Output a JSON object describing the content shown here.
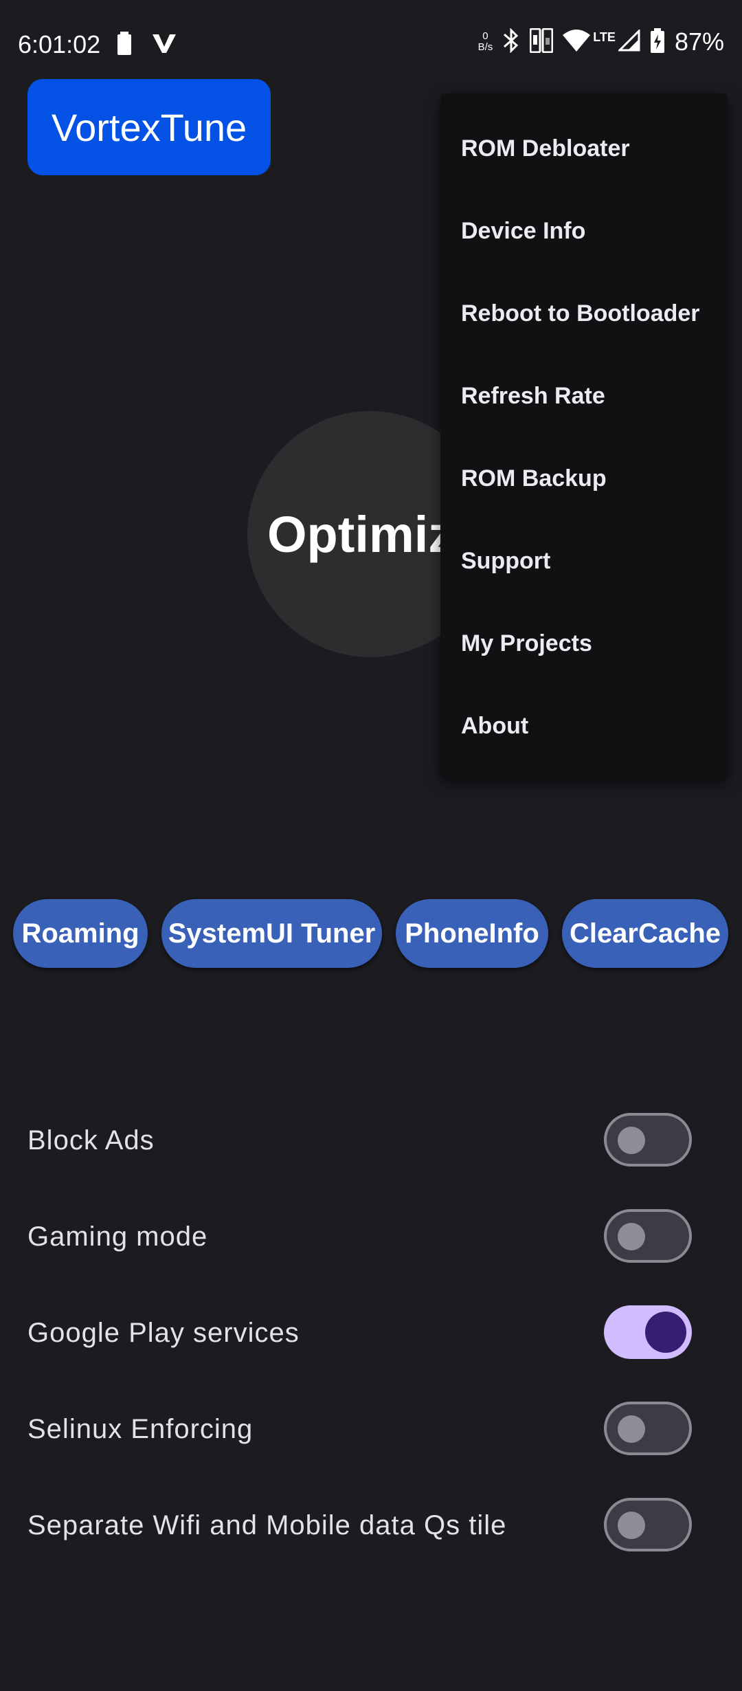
{
  "status_bar": {
    "time": "6:01:02",
    "net_speed_value": "0",
    "net_speed_unit": "B/s",
    "lte": "LTE",
    "battery": "87%",
    "icons": [
      "battery-saver-icon",
      "v-app-icon",
      "bluetooth-icon",
      "sim-icon",
      "wifi-icon",
      "signal-icon",
      "battery-charging-icon"
    ]
  },
  "app": {
    "title": "VortexTune",
    "optimize_label": "Optimiz",
    "accent_color": "#0351e5"
  },
  "menu": {
    "items": [
      {
        "label": "ROM Debloater"
      },
      {
        "label": "Device Info"
      },
      {
        "label": "Reboot to Bootloader"
      },
      {
        "label": "Refresh Rate"
      },
      {
        "label": "ROM Backup"
      },
      {
        "label": "Support"
      },
      {
        "label": "My Projects"
      },
      {
        "label": "About"
      }
    ]
  },
  "chips": [
    {
      "label": "Roaming"
    },
    {
      "label": "SystemUI Tuner"
    },
    {
      "label": "PhoneInfo"
    },
    {
      "label": "ClearCache"
    }
  ],
  "toggles": [
    {
      "label": "Block Ads",
      "checked": false
    },
    {
      "label": "Gaming mode",
      "checked": false
    },
    {
      "label": "Google Play services",
      "checked": true
    },
    {
      "label": "Selinux Enforcing",
      "checked": false
    },
    {
      "label": "Separate Wifi and Mobile data Qs tile",
      "checked": false
    }
  ]
}
